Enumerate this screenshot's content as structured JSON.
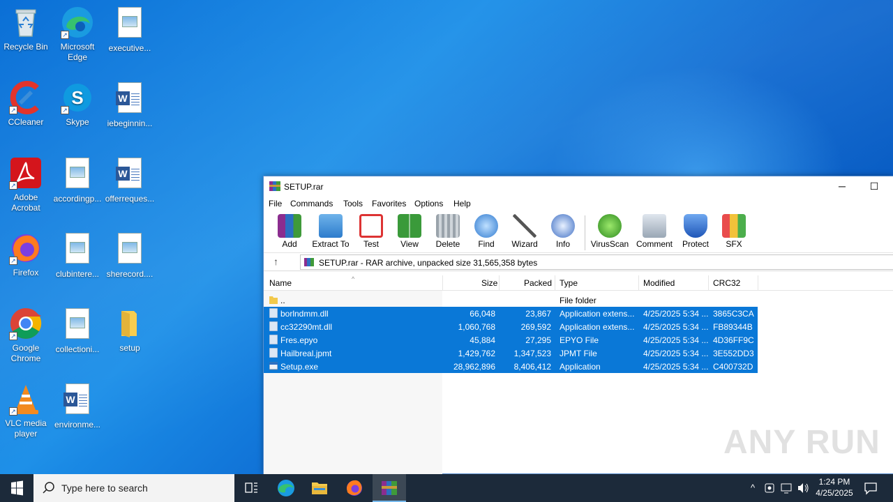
{
  "desktop": {
    "icons": [
      {
        "label": "Recycle Bin",
        "icon": "recycle-bin-icon"
      },
      {
        "label": "Microsoft Edge",
        "icon": "edge-icon"
      },
      {
        "label": "executive...",
        "icon": "image-file-icon"
      },
      {
        "label": "CCleaner",
        "icon": "ccleaner-icon"
      },
      {
        "label": "Skype",
        "icon": "skype-icon"
      },
      {
        "label": "iebeginnin...",
        "icon": "word-doc-icon"
      },
      {
        "label": "Adobe Acrobat",
        "icon": "acrobat-icon"
      },
      {
        "label": "accordingp...",
        "icon": "image-file-icon"
      },
      {
        "label": "offerreques...",
        "icon": "word-doc-icon"
      },
      {
        "label": "Firefox",
        "icon": "firefox-icon"
      },
      {
        "label": "clubintere...",
        "icon": "image-file-icon"
      },
      {
        "label": "sherecord....",
        "icon": "image-file-icon"
      },
      {
        "label": "Google Chrome",
        "icon": "chrome-icon"
      },
      {
        "label": "collectioni...",
        "icon": "image-file-icon"
      },
      {
        "label": "setup",
        "icon": "folder-icon"
      },
      {
        "label": "VLC media player",
        "icon": "vlc-icon"
      },
      {
        "label": "environme...",
        "icon": "word-doc-icon"
      }
    ]
  },
  "window": {
    "title": "SETUP.rar",
    "minimize": "─",
    "maximize": "☐",
    "menu": [
      "File",
      "Commands",
      "Tools",
      "Favorites",
      "Options",
      "Help"
    ],
    "toolbar": [
      "Add",
      "Extract To",
      "Test",
      "View",
      "Delete",
      "Find",
      "Wizard",
      "Info",
      "VirusScan",
      "Comment",
      "Protect",
      "SFX"
    ],
    "address": "SETUP.rar - RAR archive, unpacked size 31,565,358 bytes",
    "columns": {
      "name": "Name",
      "size": "Size",
      "packed": "Packed",
      "type": "Type",
      "modified": "Modified",
      "crc": "CRC32"
    },
    "rows": [
      {
        "name": "..",
        "size": "",
        "packed": "",
        "type": "File folder",
        "modified": "",
        "crc": ""
      },
      {
        "name": "borlndmm.dll",
        "size": "66,048",
        "packed": "23,867",
        "type": "Application extens...",
        "modified": "4/25/2025 5:34 ...",
        "crc": "3865C3CA"
      },
      {
        "name": "cc32290mt.dll",
        "size": "1,060,768",
        "packed": "269,592",
        "type": "Application extens...",
        "modified": "4/25/2025 5:34 ...",
        "crc": "FB89344B"
      },
      {
        "name": "Fres.epyo",
        "size": "45,884",
        "packed": "27,295",
        "type": "EPYO File",
        "modified": "4/25/2025 5:34 ...",
        "crc": "4D36FF9C"
      },
      {
        "name": "Hailbreal.jpmt",
        "size": "1,429,762",
        "packed": "1,347,523",
        "type": "JPMT File",
        "modified": "4/25/2025 5:34 ...",
        "crc": "3E552DD3"
      },
      {
        "name": "Setup.exe",
        "size": "28,962,896",
        "packed": "8,406,412",
        "type": "Application",
        "modified": "4/25/2025 5:34 ...",
        "crc": "C400732D"
      }
    ]
  },
  "watermark": "ANY RUN",
  "taskbar": {
    "search_placeholder": "Type here to search",
    "time": "1:24 PM",
    "date": "4/25/2025"
  },
  "colors": {
    "selection": "#0a78d7",
    "taskbar": "#1c2a3a",
    "desktop": "#0a6fd6"
  }
}
